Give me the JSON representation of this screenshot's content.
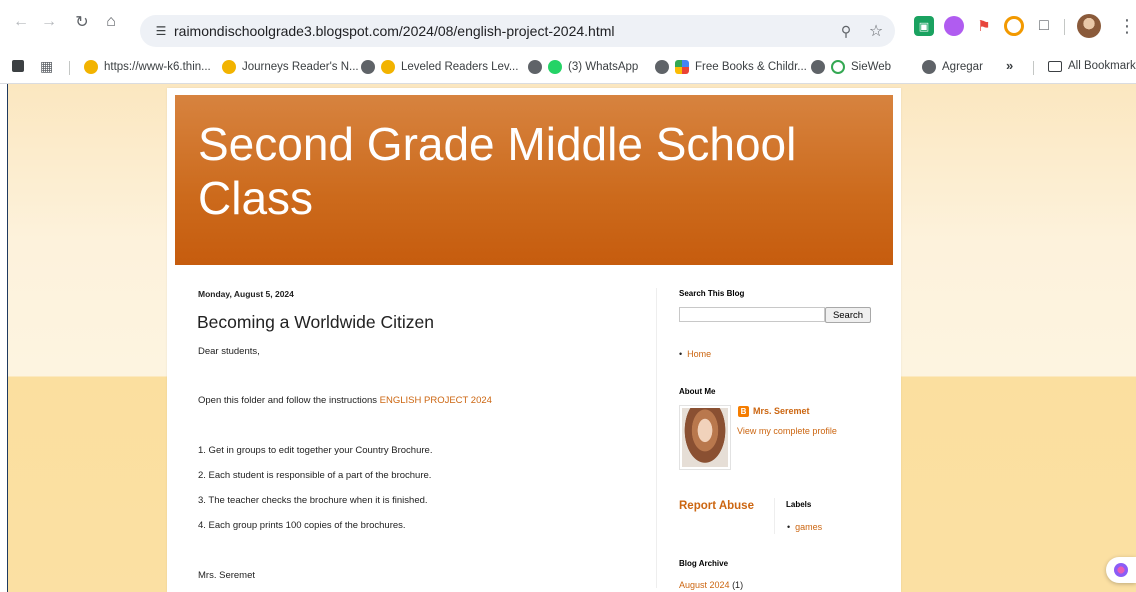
{
  "browser": {
    "url": "raimondischoolgrade3.blogspot.com/2024/08/english-project-2024.html",
    "bookmarks": [
      {
        "label": "https://www-k6.thin...",
        "icon": "circle-yellow-icon"
      },
      {
        "label": "Journeys Reader's N...",
        "icon": "circle-yellow-icon"
      },
      {
        "label": "Leveled Readers Lev...",
        "icon": "globe-icon"
      },
      {
        "label": "(3) WhatsApp",
        "icon": "whatsapp-icon"
      },
      {
        "label": "Free Books & Childr...",
        "icon": "colorful-grid-icon"
      },
      {
        "label": "SieWeb",
        "icon": "sieweb-icon"
      },
      {
        "label": "Agregar",
        "icon": "globe-icon"
      }
    ],
    "more_label": "»",
    "all_bookmarks_label": "All Bookmarks"
  },
  "blog": {
    "title": "Second Grade Middle School Class",
    "header_color": "#cc6a1c",
    "link_color": "#cc6611"
  },
  "post": {
    "date": "Monday, August 5, 2024",
    "title": "Becoming a Worldwide Citizen",
    "greeting": "Dear students,",
    "instructions_prefix": "Open this folder and follow the instructions ",
    "instructions_link": "ENGLISH PROJECT 2024",
    "steps": [
      "1. Get in groups to edit together your Country Brochure.",
      "2. Each student is responsible of a part of the brochure.",
      "3. The teacher checks the brochure when it is finished.",
      "4. Each group prints 100 copies of the brochures."
    ],
    "signature": "Mrs. Seremet"
  },
  "sidebar": {
    "search_title": "Search This Blog",
    "search_placeholder": "",
    "search_button": "Search",
    "pages": [
      "Home"
    ],
    "about_title": "About Me",
    "author_name": "Mrs. Seremet",
    "profile_link": "View my complete profile",
    "report_abuse": "Report Abuse",
    "labels_title": "Labels",
    "labels": [
      "games"
    ],
    "archive_title": "Blog Archive",
    "archive_month": "August 2024",
    "archive_count": "(1)"
  }
}
